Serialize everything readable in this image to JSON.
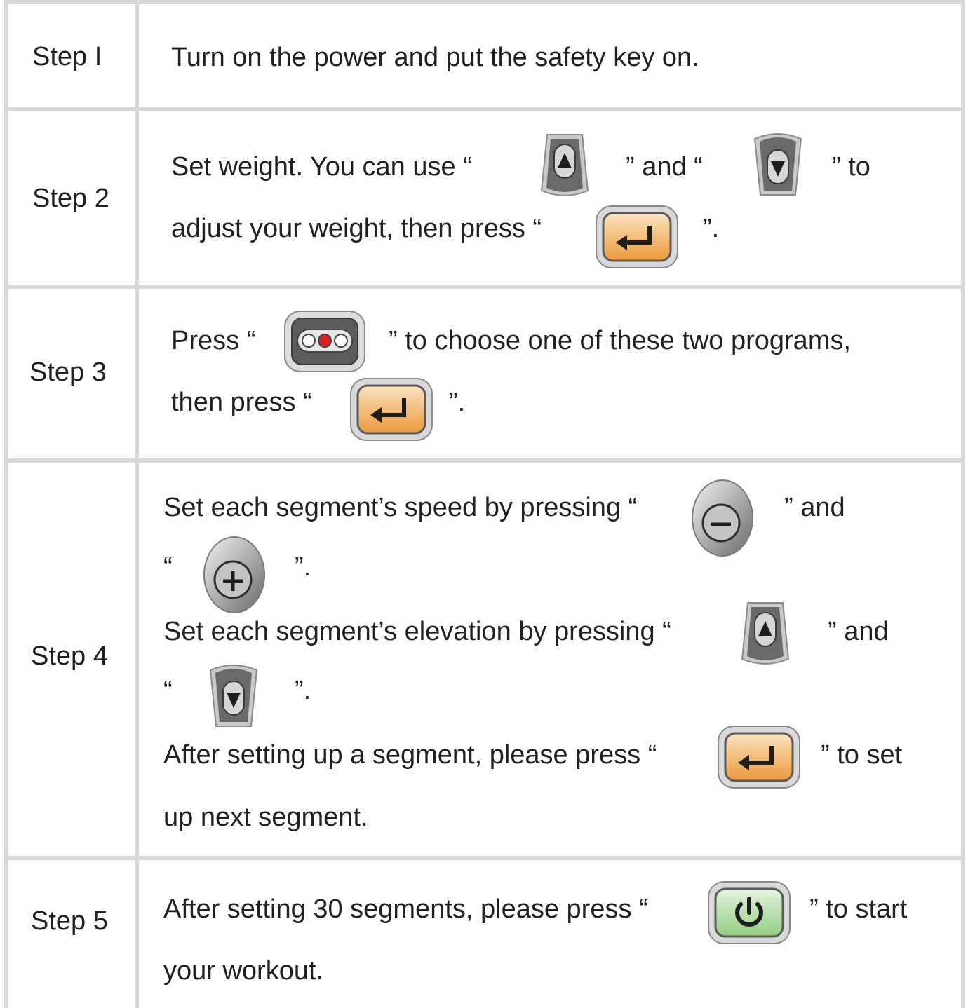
{
  "steps": [
    {
      "label": "Step I",
      "lines": [
        [
          {
            "t": "Turn on the power and put the safety key on."
          }
        ]
      ]
    },
    {
      "label": "Step 2",
      "lines": [
        [
          {
            "t": "Set weight. You can use  “"
          },
          {
            "icon": "up-arrow-icon"
          },
          {
            "t": "” and “"
          },
          {
            "icon": "down-arrow-icon"
          },
          {
            "t": "” to"
          }
        ],
        [
          {
            "t": "adjust your weight, then press “"
          },
          {
            "icon": "enter-icon"
          },
          {
            "t": "”."
          }
        ]
      ]
    },
    {
      "label": "Step 3",
      "lines": [
        [
          {
            "t": "Press  “"
          },
          {
            "icon": "program-select-icon"
          },
          {
            "t": "” to choose one of these two programs,"
          }
        ],
        [
          {
            "t": "then press “"
          },
          {
            "icon": "enter-icon"
          },
          {
            "t": "”."
          }
        ]
      ]
    },
    {
      "label": "Step 4",
      "lines": [
        [
          {
            "t": "Set each segment’s speed by pressing “"
          },
          {
            "icon": "minus-icon"
          },
          {
            "t": "” and"
          }
        ],
        [
          {
            "t": "“"
          },
          {
            "icon": "plus-icon"
          },
          {
            "t": "”."
          }
        ],
        [
          {
            "t": "Set each segment’s elevation by pressing “"
          },
          {
            "icon": "up-arrow-icon"
          },
          {
            "t": "” and"
          }
        ],
        [
          {
            "t": "“"
          },
          {
            "icon": "down-arrow-icon"
          },
          {
            "t": "”."
          }
        ],
        [
          {
            "t": "After setting up a segment, please press “"
          },
          {
            "icon": "enter-icon"
          },
          {
            "t": "” to set"
          }
        ],
        [
          {
            "t": "up next segment."
          }
        ]
      ]
    },
    {
      "label": "Step 5",
      "lines": [
        [
          {
            "t": "After setting 30 segments, please press “"
          },
          {
            "icon": "start-power-icon"
          },
          {
            "t": "” to start"
          }
        ],
        [
          {
            "t": "your workout."
          }
        ]
      ]
    }
  ],
  "colors": {
    "grid": "#d9d9d9",
    "text": "#231f20",
    "enter_button": "#f0a850",
    "start_button": "#a8d49a",
    "program_led": "#e02020"
  }
}
